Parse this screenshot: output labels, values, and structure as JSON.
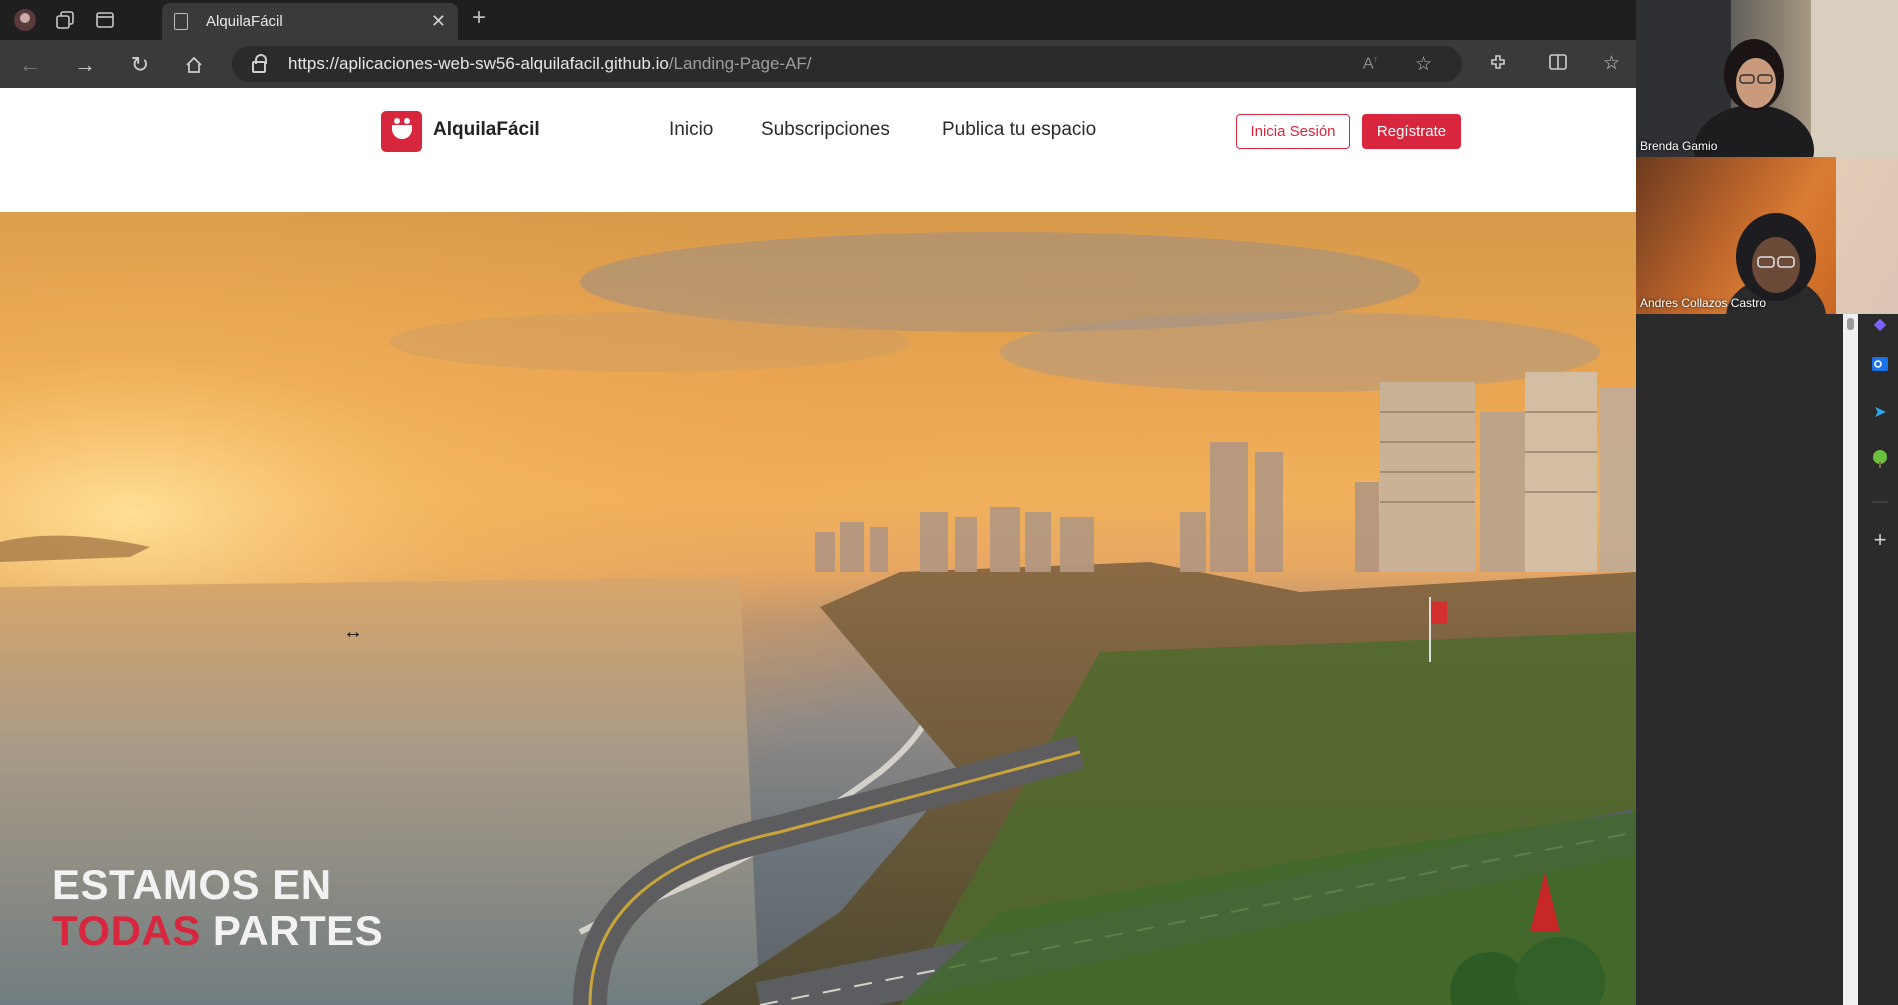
{
  "browser": {
    "tab_title": "AlquilaFácil",
    "url_host": "https://aplicaciones-web-sw56-alquilafacil.github.io",
    "url_path": "/Landing-Page-AF/"
  },
  "site": {
    "brand": "AlquilaFácil",
    "nav": [
      "Inicio",
      "Subscripciones",
      "Publica tu espacio"
    ],
    "login_label": "Inicia Sesión",
    "register_label": "Regístrate",
    "accent_color": "#d7263d"
  },
  "hero": {
    "line1": "ESTAMOS EN",
    "line2_red": "TODAS",
    "line2_white": " PARTES"
  },
  "video_call": {
    "participants": [
      "Brenda Gamio",
      "Andres Collazos Castro"
    ]
  }
}
